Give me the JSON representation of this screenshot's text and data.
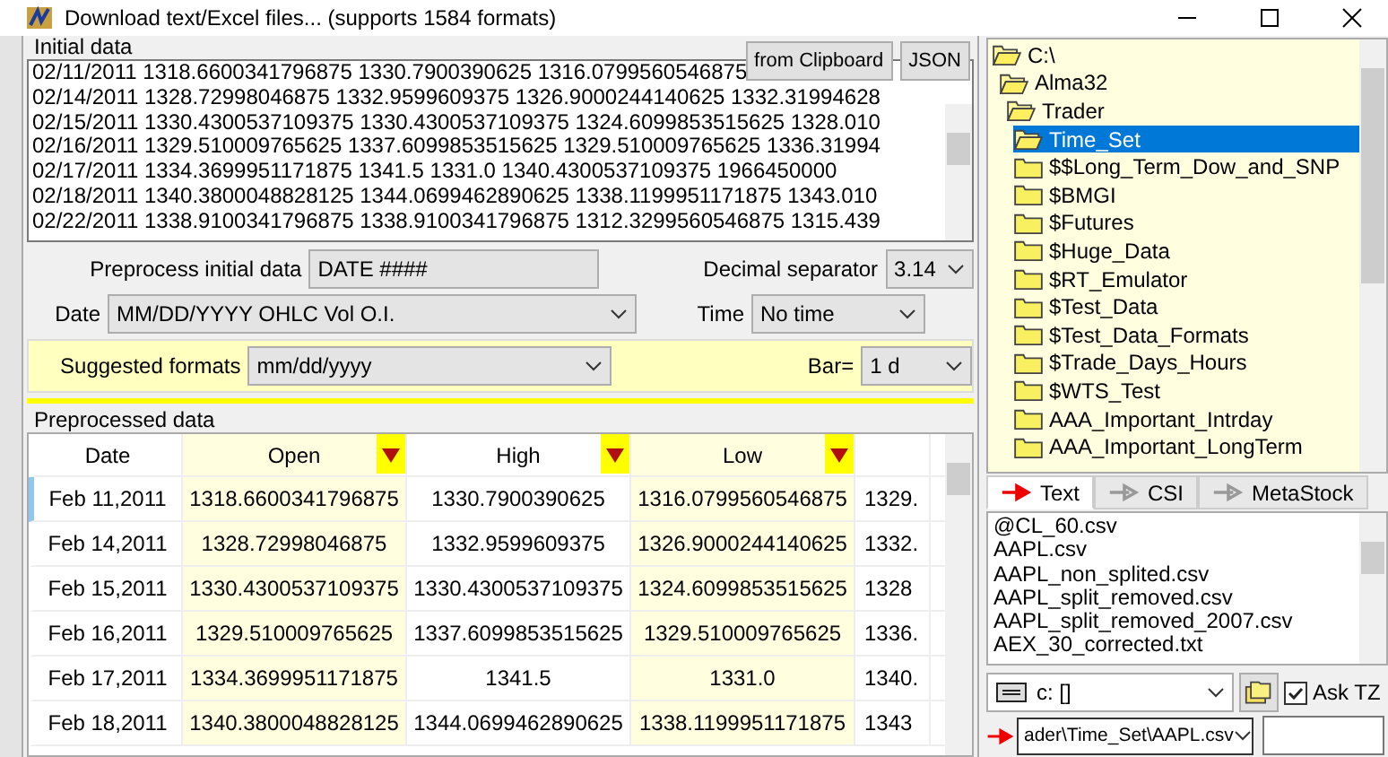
{
  "window": {
    "title": "Download text/Excel files... (supports 1584 formats)"
  },
  "initial_data": {
    "label": "Initial data",
    "buttons": [
      "from Clipboard",
      "JSON"
    ],
    "lines": [
      "02/11/2011 1318.6600341796875 1330.7900390625 1316.0799560546875",
      "02/14/2011 1328.72998046875 1332.9599609375 1326.9000244140625 1332.31994628",
      "02/15/2011 1330.4300537109375 1330.4300537109375 1324.6099853515625 1328.010",
      "02/16/2011 1329.510009765625 1337.6099853515625 1329.510009765625 1336.31994",
      "02/17/2011 1334.3699951171875 1341.5 1331.0 1340.4300537109375 1966450000",
      "02/18/2011 1340.3800048828125 1344.0699462890625 1338.1199951171875 1343.010",
      "02/22/2011 1338.9100341796875 1338.9100341796875 1312.3299560546875 1315.439"
    ]
  },
  "options": {
    "preprocess": {
      "label": "Preprocess initial data",
      "value": "DATE ####"
    },
    "decimal": {
      "label": "Decimal separator",
      "value": "3.14"
    },
    "date": {
      "label": "Date",
      "value": "MM/DD/YYYY  OHLC Vol O.I."
    },
    "time": {
      "label": "Time",
      "value": "No time"
    },
    "suggested": {
      "label": "Suggested formats",
      "value": "mm/dd/yyyy"
    },
    "bar": {
      "label": "Bar=",
      "value": "1 d"
    }
  },
  "preprocessed": {
    "label": "Preprocessed data",
    "columns": [
      {
        "label": "Date",
        "filter": false,
        "tinted": false
      },
      {
        "label": "Open",
        "filter": true,
        "tinted": true
      },
      {
        "label": "High",
        "filter": true,
        "tinted": false
      },
      {
        "label": "Low",
        "filter": true,
        "tinted": true
      },
      {
        "filter": false,
        "tinted": false
      }
    ],
    "rows": [
      {
        "selected": true,
        "cells": [
          "Feb 11,2011",
          "1318.6600341796875",
          "1330.7900390625",
          "1316.0799560546875",
          "1329."
        ]
      },
      {
        "selected": false,
        "cells": [
          "Feb 14,2011",
          "1328.72998046875",
          "1332.9599609375",
          "1326.9000244140625",
          "1332."
        ]
      },
      {
        "selected": false,
        "cells": [
          "Feb 15,2011",
          "1330.4300537109375",
          "1330.4300537109375",
          "1324.6099853515625",
          "1328"
        ]
      },
      {
        "selected": false,
        "cells": [
          "Feb 16,2011",
          "1329.510009765625",
          "1337.6099853515625",
          "1329.510009765625",
          "1336."
        ]
      },
      {
        "selected": false,
        "cells": [
          "Feb 17,2011",
          "1334.3699951171875",
          "1341.5",
          "1331.0",
          "1340."
        ]
      },
      {
        "selected": false,
        "cells": [
          "Feb 18,2011",
          "1340.3800048828125",
          "1344.0699462890625",
          "1338.1199951171875",
          "1343"
        ]
      }
    ]
  },
  "folder_tree": [
    {
      "label": "C:\\",
      "open": true,
      "selected": false,
      "children": [
        {
          "label": "Alma32",
          "open": true,
          "selected": false,
          "children": [
            {
              "label": "Trader",
              "open": true,
              "selected": false,
              "children": [
                {
                  "label": "Time_Set",
                  "open": true,
                  "selected": true
                },
                {
                  "label": "$$Long_Term_Dow_and_SNP",
                  "open": false,
                  "selected": false
                },
                {
                  "label": "$BMGI",
                  "open": false,
                  "selected": false
                },
                {
                  "label": "$Futures",
                  "open": false,
                  "selected": false
                },
                {
                  "label": "$Huge_Data",
                  "open": false,
                  "selected": false
                },
                {
                  "label": "$RT_Emulator",
                  "open": false,
                  "selected": false
                },
                {
                  "label": "$Test_Data",
                  "open": false,
                  "selected": false
                },
                {
                  "label": "$Test_Data_Formats",
                  "open": false,
                  "selected": false
                },
                {
                  "label": "$Trade_Days_Hours",
                  "open": false,
                  "selected": false
                },
                {
                  "label": "$WTS_Test",
                  "open": false,
                  "selected": false
                },
                {
                  "label": "AAA_Important_Intrday",
                  "open": false,
                  "selected": false
                },
                {
                  "label": "AAA_Important_LongTerm",
                  "open": false,
                  "selected": false
                }
              ]
            }
          ]
        }
      ]
    }
  ],
  "format_tabs": [
    {
      "label": "Text",
      "selected": true
    },
    {
      "label": "CSI",
      "selected": false
    },
    {
      "label": "MetaStock",
      "selected": false
    }
  ],
  "files": [
    "@CL_60.csv",
    "AAPL.csv",
    "AAPL_non_splited.csv",
    "AAPL_split_removed.csv",
    "AAPL_split_removed_2007.csv",
    "AEX_30_corrected.txt"
  ],
  "drive": {
    "value": "c: []"
  },
  "ask_tz": {
    "label": "Ask TZ",
    "checked": true
  },
  "path": {
    "value": "ader\\Time_Set\\AAPL.csv"
  }
}
